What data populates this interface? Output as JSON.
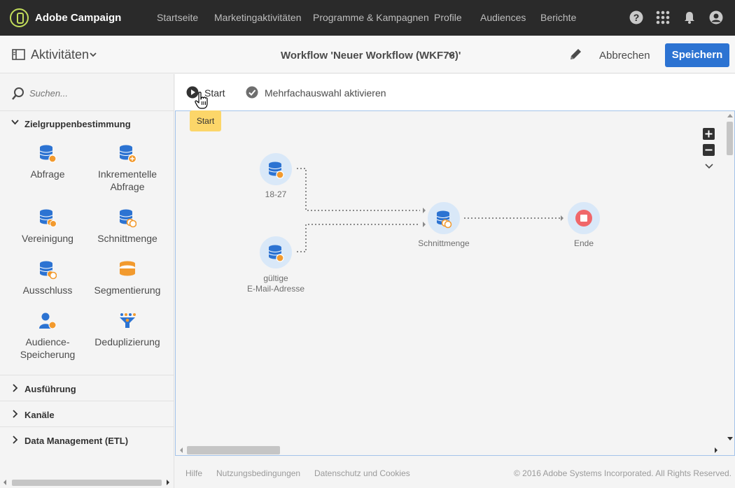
{
  "app": {
    "brand": "Adobe Campaign",
    "nav": [
      "Startseite",
      "Marketingaktivitäten",
      "Programme & Kampagnen",
      "Profile",
      "Audiences",
      "Berichte"
    ]
  },
  "header": {
    "activities_label": "Aktivitäten",
    "workflow_title": "Workflow 'Neuer Workflow (WKF76)'",
    "cancel_label": "Abbrechen",
    "save_label": "Speichern"
  },
  "sidebar": {
    "search_placeholder": "Suchen...",
    "sections": [
      {
        "label": "Zielgruppenbestimmung",
        "expanded": true
      },
      {
        "label": "Ausführung",
        "expanded": false
      },
      {
        "label": "Kanäle",
        "expanded": false
      },
      {
        "label": "Data Management (ETL)",
        "expanded": false
      }
    ],
    "activities": [
      {
        "label": "Abfrage",
        "icon": "query-icon"
      },
      {
        "label": "Inkrementelle Abfrage",
        "icon": "incremental-query-icon"
      },
      {
        "label": "Vereinigung",
        "icon": "union-icon"
      },
      {
        "label": "Schnittmenge",
        "icon": "intersection-icon"
      },
      {
        "label": "Ausschluss",
        "icon": "exclusion-icon"
      },
      {
        "label": "Segmentierung",
        "icon": "segmentation-icon"
      },
      {
        "label": "Audience-Speicherung",
        "icon": "save-audience-icon"
      },
      {
        "label": "Deduplizierung",
        "icon": "deduplication-icon"
      }
    ]
  },
  "toolbar": {
    "start_label": "Start",
    "multiselect_label": "Mehrfachauswahl aktivieren",
    "tooltip": "Start"
  },
  "workflow": {
    "nodes": [
      {
        "label": "18-27"
      },
      {
        "label_line1": "gültige",
        "label_line2": "E-Mail-Adresse"
      },
      {
        "label": "Schnittmenge"
      },
      {
        "label": "Ende"
      }
    ]
  },
  "footer": {
    "help": "Hilfe",
    "terms": "Nutzungsbedingungen",
    "privacy": "Datenschutz und Cookies",
    "copyright": "© 2016 Adobe Systems Incorporated. All Rights Reserved."
  },
  "colors": {
    "topbar": "#2a2a2a",
    "accent_blue": "#2c73d2",
    "logo_green": "#c2dd5a",
    "node_fill": "#d9e8f8",
    "db_blue": "#2c73d2",
    "badge_orange": "#f29a2e",
    "end_red": "#f0676a",
    "tooltip_yellow": "#fcd669"
  }
}
